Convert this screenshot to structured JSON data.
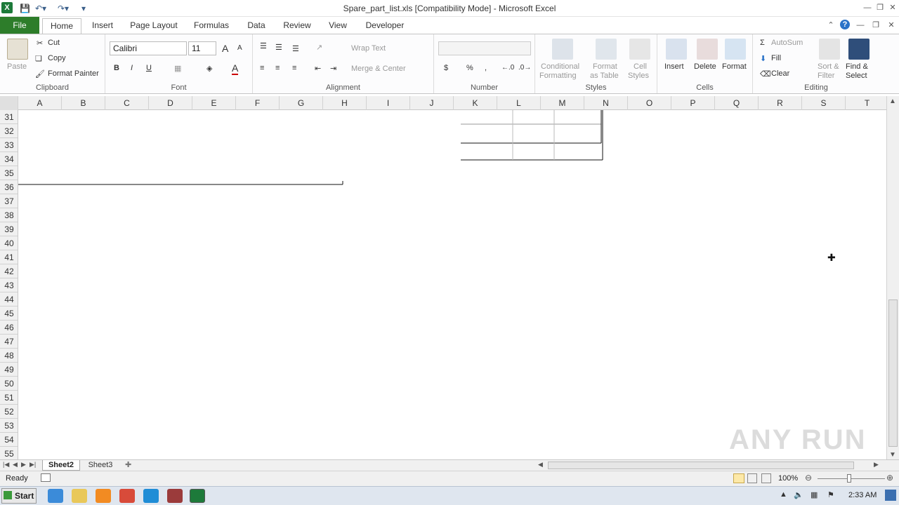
{
  "titlebar": {
    "app_icon": "X",
    "title": "Spare_part_list.xls  [Compatibility Mode]  -  Microsoft Excel",
    "qat": [
      "save-icon",
      "undo-icon",
      "redo-icon",
      "customize-icon"
    ]
  },
  "tabs": {
    "file": "File",
    "items": [
      {
        "label": "Home"
      },
      {
        "label": "Insert"
      },
      {
        "label": "Page Layout"
      },
      {
        "label": "Formulas"
      },
      {
        "label": "Data"
      },
      {
        "label": "Review"
      },
      {
        "label": "View"
      },
      {
        "label": "Developer"
      }
    ]
  },
  "ribbon": {
    "clipboard": {
      "label": "Clipboard",
      "paste": "Paste",
      "cut": "Cut",
      "copy": "Copy",
      "format_painter": "Format Painter"
    },
    "font": {
      "label": "Font",
      "name": "Calibri",
      "size": "11",
      "bold": "B",
      "italic": "I",
      "underline": "U",
      "grow": "A",
      "shrink": "A"
    },
    "alignment": {
      "label": "Alignment",
      "wrap_text": "Wrap Text",
      "merge_center": "Merge & Center"
    },
    "number": {
      "label": "Number",
      "format": "",
      "currency": "$",
      "percent": "%",
      "comma": ","
    },
    "styles": {
      "label": "Styles",
      "conditional": "Conditional",
      "conditional2": "Formatting",
      "format_table": "Format",
      "format_table2": "as Table",
      "cell_styles": "Cell",
      "cell_styles2": "Styles"
    },
    "cells": {
      "label": "Cells",
      "insert": "Insert",
      "delete": "Delete",
      "format": "Format"
    },
    "editing": {
      "label": "Editing",
      "autosum": "AutoSum",
      "fill": "Fill",
      "clear": "Clear",
      "sort": "Sort &",
      "sort2": "Filter",
      "find": "Find &",
      "find2": "Select"
    }
  },
  "columns": [
    "A",
    "B",
    "C",
    "D",
    "E",
    "F",
    "G",
    "H",
    "I",
    "J",
    "K",
    "L",
    "M",
    "N",
    "O",
    "P",
    "Q",
    "R",
    "S",
    "T"
  ],
  "rows": [
    "31",
    "32",
    "33",
    "34",
    "35",
    "36",
    "37",
    "38",
    "39",
    "40",
    "41",
    "42",
    "43",
    "44",
    "45",
    "46",
    "47",
    "48",
    "49",
    "50",
    "51",
    "52",
    "53",
    "54",
    "55"
  ],
  "sheets": [
    {
      "label": "Sheet2",
      "active": true
    },
    {
      "label": "Sheet3",
      "active": false
    }
  ],
  "status": {
    "ready": "Ready",
    "zoom": "100%"
  },
  "taskbar": {
    "start": "Start",
    "clock": "2:33 AM"
  },
  "watermark": "ANY RUN"
}
